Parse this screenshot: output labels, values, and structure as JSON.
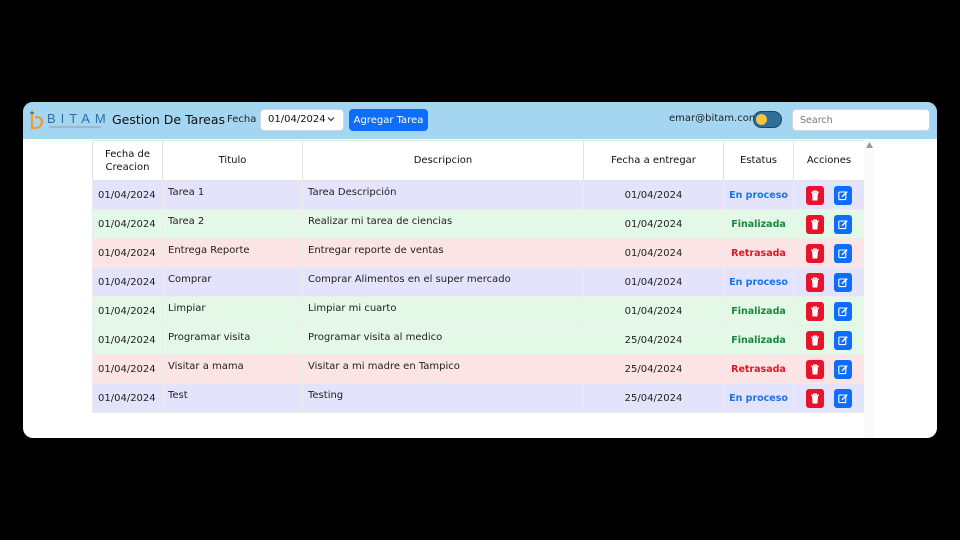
{
  "header": {
    "brand": "BITAM",
    "app_title": "Gestion De Tareas",
    "date_label": "Fecha",
    "date_value": "01/04/2024",
    "add_button": "Agregar Tarea",
    "user_email": "emar@bitam.com",
    "search_placeholder": "Search",
    "accent_color": "#0d6efd",
    "bar_color": "#a4d6f2"
  },
  "table": {
    "columns": [
      "Fecha de Creacion",
      "Titulo",
      "Descripcion",
      "Fecha a entregar",
      "Estatus",
      "Acciones"
    ],
    "rows": [
      {
        "created": "01/04/2024",
        "title": "Tarea 1",
        "description": "Tarea Descripción",
        "due": "01/04/2024",
        "status": "En proceso"
      },
      {
        "created": "01/04/2024",
        "title": "Tarea 2",
        "description": "Realizar mi tarea de ciencias",
        "due": "01/04/2024",
        "status": "Finalizada"
      },
      {
        "created": "01/04/2024",
        "title": "Entrega Reporte",
        "description": "Entregar reporte de ventas",
        "due": "01/04/2024",
        "status": "Retrasada"
      },
      {
        "created": "01/04/2024",
        "title": "Comprar",
        "description": "Comprar Alimentos en el super mercado",
        "due": "01/04/2024",
        "status": "En proceso"
      },
      {
        "created": "01/04/2024",
        "title": "Limpiar",
        "description": "Limpiar mi cuarto",
        "due": "01/04/2024",
        "status": "Finalizada"
      },
      {
        "created": "01/04/2024",
        "title": "Programar visita",
        "description": "Programar visita al medico",
        "due": "25/04/2024",
        "status": "Finalizada"
      },
      {
        "created": "01/04/2024",
        "title": "Visitar a mama",
        "description": "Visitar a mi madre en Tampico",
        "due": "25/04/2024",
        "status": "Retrasada"
      },
      {
        "created": "01/04/2024",
        "title": "Test",
        "description": "Testing",
        "due": "25/04/2024",
        "status": "En proceso"
      }
    ],
    "status_colors": {
      "En proceso": "#1a73e8",
      "Finalizada": "#18873d",
      "Retrasada": "#e4132b"
    },
    "row_colors": {
      "En proceso": "#e3e4fb",
      "Finalizada": "#e3f8e7",
      "Retrasada": "#fce4e4"
    },
    "action_icons": [
      "trash-icon",
      "edit-icon"
    ]
  }
}
